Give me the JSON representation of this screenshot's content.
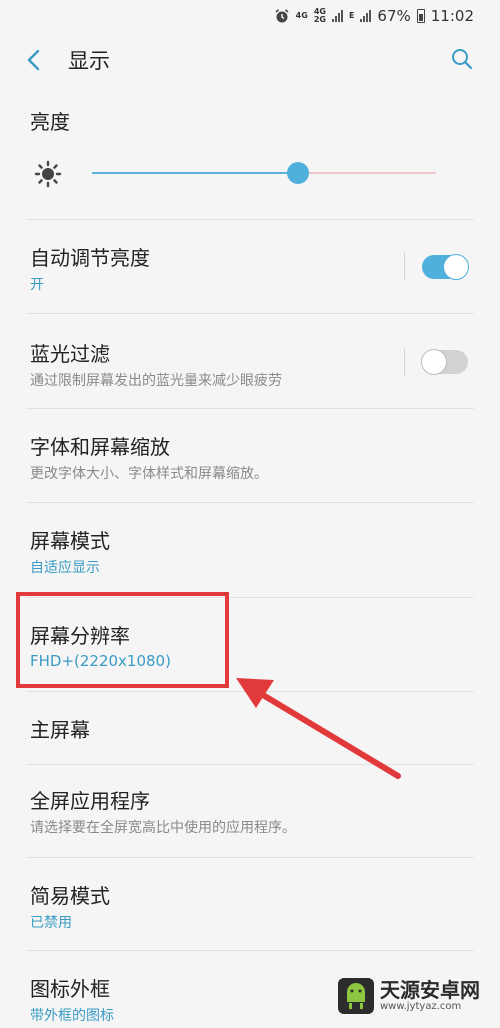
{
  "status_bar": {
    "alarm_icon": "alarm-clock-icon",
    "net1": "4G",
    "net2": "4G\n2G",
    "net3": "E",
    "battery_percent": "67%",
    "time": "11:02"
  },
  "app_bar": {
    "title": "显示",
    "back_icon": "back-chevron-icon",
    "search_icon": "search-icon"
  },
  "brightness": {
    "title": "亮度",
    "level": 0.6
  },
  "auto_brightness": {
    "title": "自动调节亮度",
    "subtitle": "开",
    "enabled": true
  },
  "blue_light": {
    "title": "蓝光过滤",
    "subtitle": "通过限制屏幕发出的蓝光量来减少眼疲劳",
    "enabled": false
  },
  "font_zoom": {
    "title": "字体和屏幕缩放",
    "subtitle": "更改字体大小、字体样式和屏幕缩放。"
  },
  "screen_mode": {
    "title": "屏幕模式",
    "subtitle": "自适应显示"
  },
  "resolution": {
    "title": "屏幕分辨率",
    "subtitle": "FHD+(2220x1080)"
  },
  "home_screen": {
    "title": "主屏幕"
  },
  "fullscreen_apps": {
    "title": "全屏应用程序",
    "subtitle": "请选择要在全屏宽高比中使用的应用程序。"
  },
  "easy_mode": {
    "title": "简易模式",
    "subtitle": "已禁用"
  },
  "icon_frames": {
    "title": "图标外框",
    "subtitle": "带外框的图标"
  },
  "watermark": {
    "name": "天源安卓网",
    "url": "www.jytyaz.com"
  },
  "colors": {
    "accent": "#3a9bc4",
    "highlight": "#e23a3a"
  }
}
